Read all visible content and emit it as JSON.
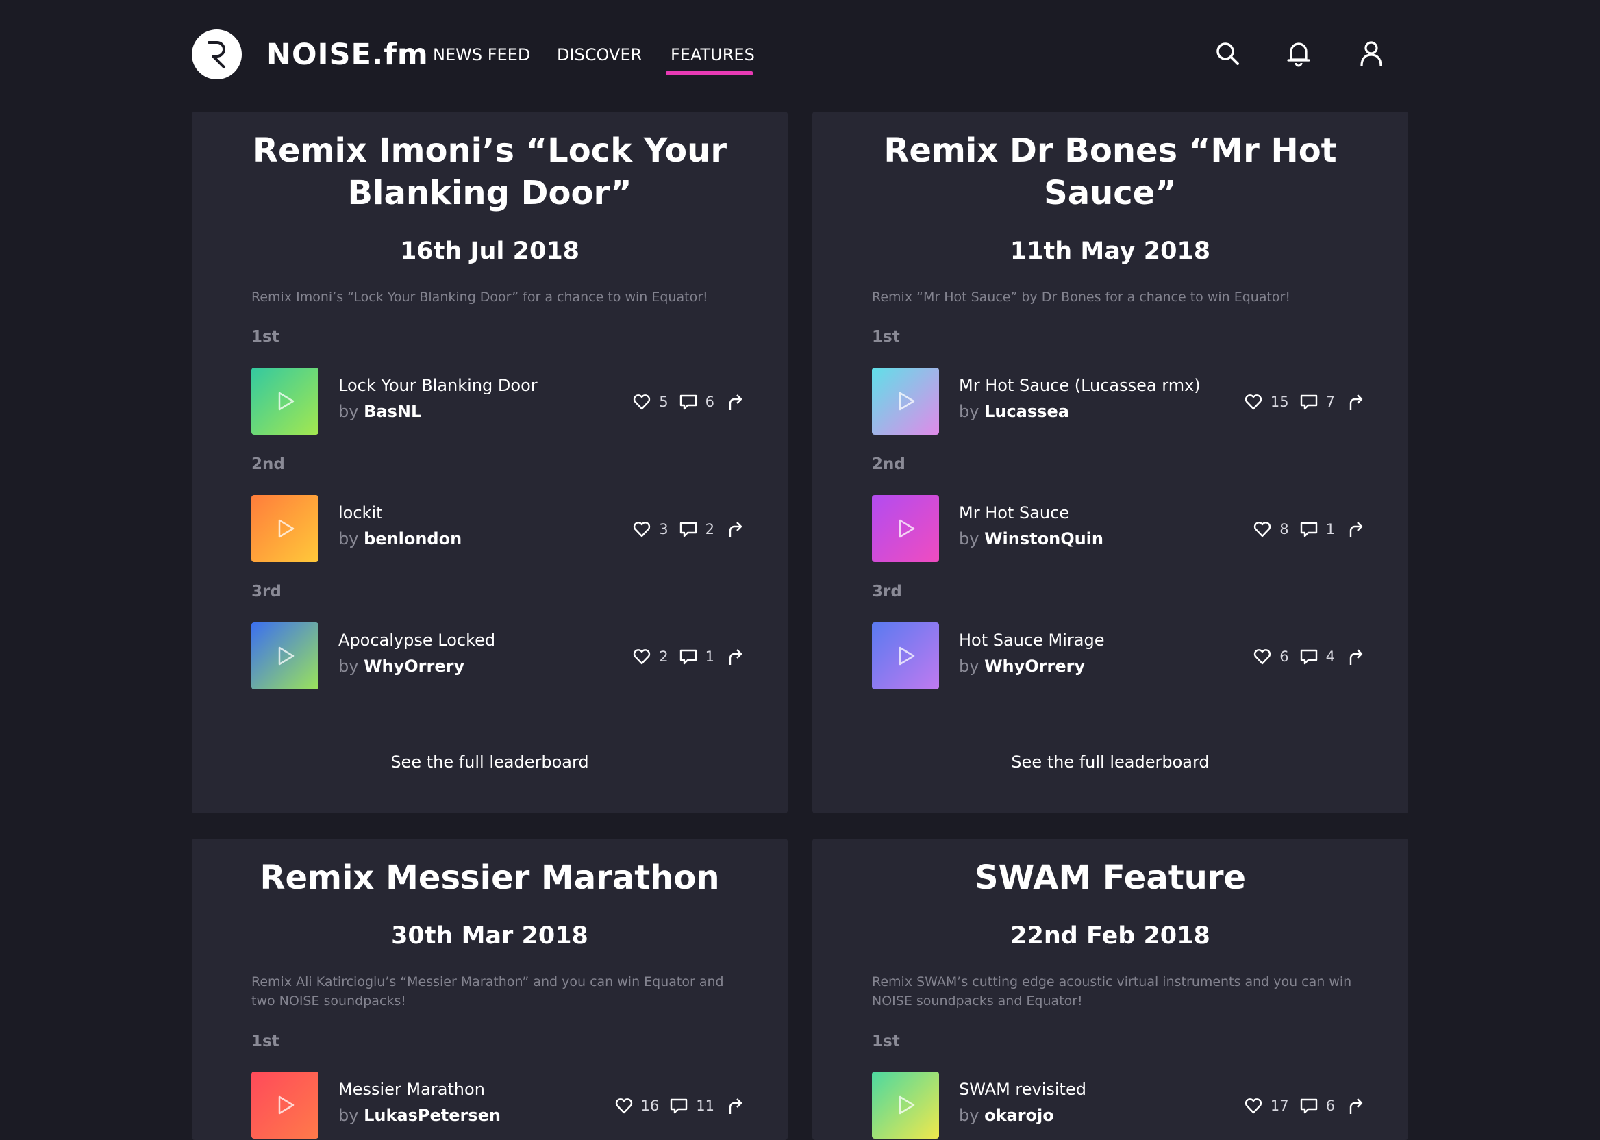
{
  "brand": {
    "name": "NOISE.fm"
  },
  "nav": [
    {
      "label": "NEWS FEED"
    },
    {
      "label": "DISCOVER"
    },
    {
      "label": "FEATURES",
      "active": true
    }
  ],
  "colors": {
    "accent": "#e83ab4",
    "background": "#1b1b24",
    "card": "#272733"
  },
  "cards": [
    {
      "title": "Remix Imoni’s “Lock Your Blanking Door”",
      "date": "16th Jul 2018",
      "description": "Remix Imoni’s “Lock Your Blanking Door” for a chance to win Equator!",
      "entries": [
        {
          "place": "1st",
          "title": "Lock Your Blanking Door",
          "by": "by",
          "artist": "BasNL",
          "likes": "5",
          "comments": "6",
          "gradient": [
            "#33c9a0",
            "#a4e84f"
          ]
        },
        {
          "place": "2nd",
          "title": "lockit",
          "by": "by",
          "artist": "benlondon",
          "likes": "3",
          "comments": "2",
          "gradient": [
            "#ff7d3b",
            "#ffc93a"
          ]
        },
        {
          "place": "3rd",
          "title": "Apocalypse Locked",
          "by": "by",
          "artist": "WhyOrrery",
          "likes": "2",
          "comments": "1",
          "gradient": [
            "#3b6ff0",
            "#9be35a"
          ]
        }
      ],
      "link": "See the full leaderboard"
    },
    {
      "title": "Remix Dr Bones “Mr Hot Sauce”",
      "date": "11th May 2018",
      "description": "Remix “Mr Hot Sauce” by Dr Bones for a chance to win Equator!",
      "entries": [
        {
          "place": "1st",
          "title": "Mr Hot Sauce (Lucassea rmx)",
          "by": "by",
          "artist": "Lucassea",
          "likes": "15",
          "comments": "7",
          "gradient": [
            "#5fe0e8",
            "#e08ae8"
          ]
        },
        {
          "place": "2nd",
          "title": "Mr Hot Sauce",
          "by": "by",
          "artist": "WinstonQuin",
          "likes": "8",
          "comments": "1",
          "gradient": [
            "#b24cf0",
            "#f04cc0"
          ]
        },
        {
          "place": "3rd",
          "title": "Hot Sauce Mirage",
          "by": "by",
          "artist": "WhyOrrery",
          "likes": "6",
          "comments": "4",
          "gradient": [
            "#5a7af0",
            "#c07af0"
          ]
        }
      ],
      "link": "See the full leaderboard"
    },
    {
      "title": "Remix Messier Marathon",
      "date": "30th Mar 2018",
      "description": "Remix Ali Katircioglu’s “Messier Marathon” and you can win Equator and two NOISE soundpacks!",
      "entries": [
        {
          "place": "1st",
          "title": "Messier Marathon",
          "by": "by",
          "artist": "LukasPetersen",
          "likes": "16",
          "comments": "11",
          "gradient": [
            "#ff4a5a",
            "#ff7a4a"
          ]
        }
      ]
    },
    {
      "title": "SWAM Feature",
      "date": "22nd Feb 2018",
      "description": "Remix SWAM’s cutting edge acoustic virtual instruments and you can win NOISE soundpacks and Equator!",
      "entries": [
        {
          "place": "1st",
          "title": "SWAM revisited",
          "by": "by",
          "artist": "okarojo",
          "likes": "17",
          "comments": "6",
          "gradient": [
            "#4cd8a0",
            "#f0e84c"
          ]
        }
      ]
    }
  ]
}
